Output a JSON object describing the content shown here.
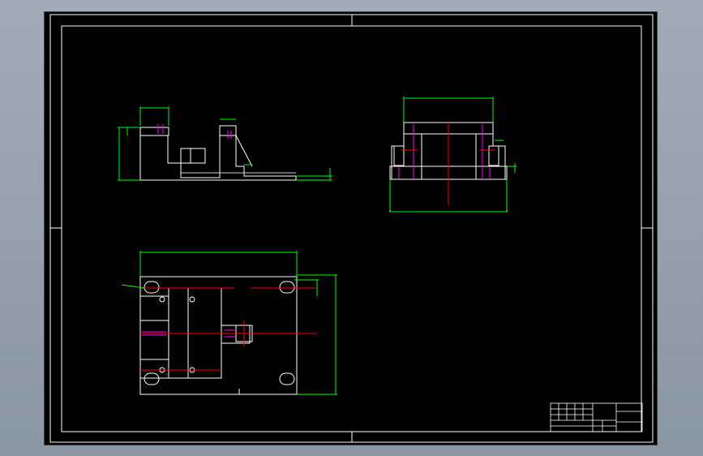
{
  "colors": {
    "background": "#000000",
    "outline": "#ffffff",
    "dimension": "#00ff00",
    "centerline": "#ff0000",
    "hidden": "#ff00ff",
    "chrome": "#9aa4b0"
  },
  "title_block": {
    "drawing_name": "",
    "rows": [
      "",
      "",
      "",
      ""
    ]
  }
}
